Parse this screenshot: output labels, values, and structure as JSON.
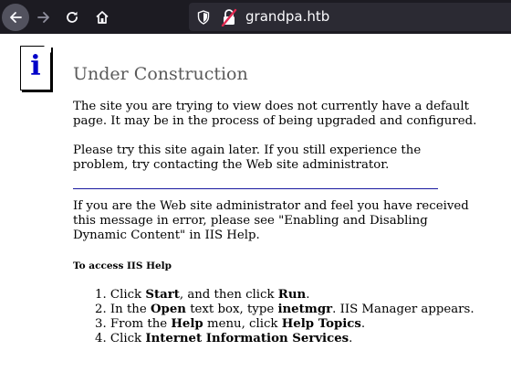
{
  "browser": {
    "url": "grandpa.htb",
    "back_label": "Back",
    "forward_label": "Forward",
    "reload_label": "Reload",
    "home_label": "Home"
  },
  "page": {
    "title": "Under Construction",
    "info_glyph": "i",
    "paragraph1_line1": "The site you are trying to view does not currently have a default",
    "paragraph1_line2": "page. It may be in the process of being upgraded and configured.",
    "paragraph2_line1": "Please try this site again later. If you still experience the",
    "paragraph2_line2": "problem, try contacting the Web site administrator.",
    "paragraph3_line1": "If you are the Web site administrator and feel you have received",
    "paragraph3_line2": "this message in error, please see \"Enabling and Disabling",
    "paragraph3_line3": "Dynamic Content\" in IIS Help.",
    "subheading": "To access IIS Help",
    "steps": [
      {
        "num": "1.",
        "a": "Click ",
        "b1": "Start",
        "c": ", and then click ",
        "b2": "Run",
        "d": "."
      },
      {
        "num": "2.",
        "a": "In the ",
        "b1": "Open",
        "c": " text box, type ",
        "b2": "inetmgr",
        "d": ". IIS Manager appears."
      },
      {
        "num": "3.",
        "a": "From the ",
        "b1": "Help",
        "c": " menu, click ",
        "b2": "Help Topics",
        "d": "."
      },
      {
        "num": "4.",
        "a": "Click ",
        "b1": "Internet Information Services",
        "c": "",
        "b2": "",
        "d": "."
      }
    ]
  },
  "colors": {
    "toolbar_bg": "#1c1b22",
    "urlbar_bg": "#2b2a33",
    "title": "#5a5a5a",
    "divider": "#1a1aa0",
    "info_glyph": "#0000c8"
  }
}
